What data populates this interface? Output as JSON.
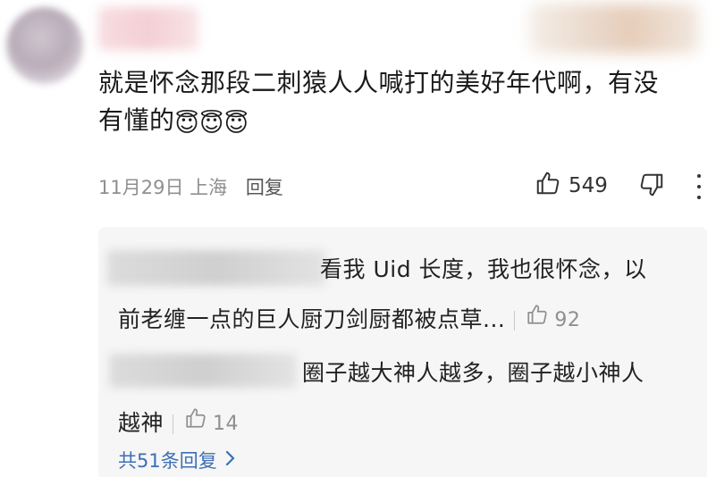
{
  "comment": {
    "text_line1": "就是怀念那段二刺猿人人喊打的美好年代啊，有没",
    "text_line2": "有懂的",
    "emojis": [
      "😇",
      "😇",
      "😇"
    ],
    "date": "11月29日",
    "location": "上海",
    "reply_label": "回复",
    "likes": "549"
  },
  "replies": [
    {
      "text_line1": "看我 Uid 长度，我也很怀念，以",
      "text_line2": "前老缠一点的巨人厨刀剑厨都被点草...",
      "likes": "92"
    },
    {
      "text_line1": "圈子越大神人越多，圈子越小神人",
      "text_line2": "越神",
      "likes": "14"
    }
  ],
  "all_replies_label": "共51条回复",
  "icons": [
    "thumbs-up-icon",
    "thumbs-down-icon",
    "more-vertical-icon",
    "chevron-right-icon"
  ]
}
